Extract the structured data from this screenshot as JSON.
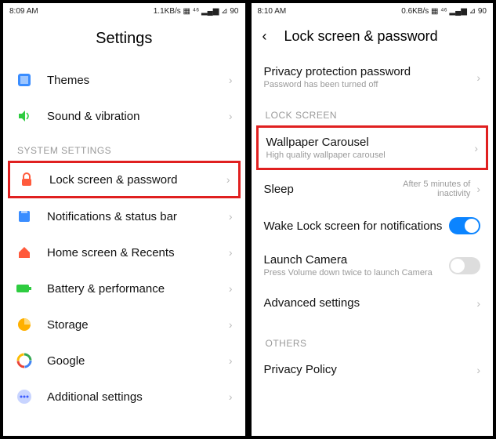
{
  "left": {
    "status": {
      "time": "8:09 AM",
      "right": "1.1KB/s ▦ ⁴⁶ ▂▄▆ ⊿ 90"
    },
    "title": "Settings",
    "rows": [
      {
        "icon": "themes",
        "label": "Themes"
      },
      {
        "icon": "sound",
        "label": "Sound & vibration"
      }
    ],
    "section": "SYSTEM SETTINGS",
    "system_rows": [
      {
        "icon": "lock",
        "label": "Lock screen & password",
        "hl": true
      },
      {
        "icon": "notif",
        "label": "Notifications & status bar"
      },
      {
        "icon": "home",
        "label": "Home screen & Recents"
      },
      {
        "icon": "battery",
        "label": "Battery & performance"
      },
      {
        "icon": "storage",
        "label": "Storage"
      },
      {
        "icon": "google",
        "label": "Google"
      },
      {
        "icon": "additional",
        "label": "Additional settings"
      }
    ]
  },
  "right": {
    "status": {
      "time": "8:10 AM",
      "right": "0.6KB/s ▦ ⁴⁶ ▂▄▆ ⊿ 90"
    },
    "title": "Lock screen & password",
    "privacy": {
      "label": "Privacy protection password",
      "sub": "Password has been turned off"
    },
    "section": "LOCK SCREEN",
    "carousel": {
      "label": "Wallpaper Carousel",
      "sub": "High quality wallpaper carousel"
    },
    "sleep": {
      "label": "Sleep",
      "value": "After 5 minutes of inactivity"
    },
    "wake": {
      "label": "Wake Lock screen for notifications"
    },
    "camera": {
      "label": "Launch Camera",
      "sub": "Press Volume down twice to launch Camera"
    },
    "advanced": {
      "label": "Advanced settings"
    },
    "others_section": "OTHERS",
    "policy": {
      "label": "Privacy Policy"
    }
  }
}
